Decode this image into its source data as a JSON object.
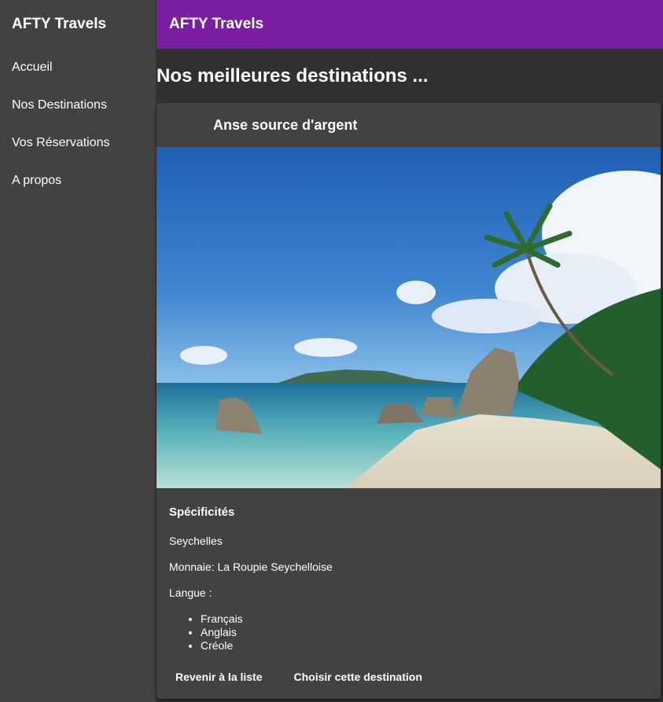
{
  "sidebar": {
    "brand": "AFTY Travels",
    "items": [
      {
        "label": "Accueil"
      },
      {
        "label": "Nos Destinations"
      },
      {
        "label": "Vos Réservations"
      },
      {
        "label": "A propos"
      }
    ]
  },
  "toolbar": {
    "title": "AFTY Travels"
  },
  "main": {
    "heading": "Nos meilleures destinations ..."
  },
  "card": {
    "title": "Anse source d'argent",
    "spec_heading": "Spécificités",
    "country": "Seychelles",
    "currency": "Monnaie: La Roupie Seychelloise",
    "language_label": "Langue :",
    "languages": [
      "Français",
      "Anglais",
      "Créole"
    ],
    "back_button": "Revenir à la liste",
    "choose_button": "Choisir cette destination"
  },
  "colors": {
    "toolbar": "#7b1fa2",
    "sidebar": "#424242",
    "background": "#303030",
    "card": "#424242"
  }
}
